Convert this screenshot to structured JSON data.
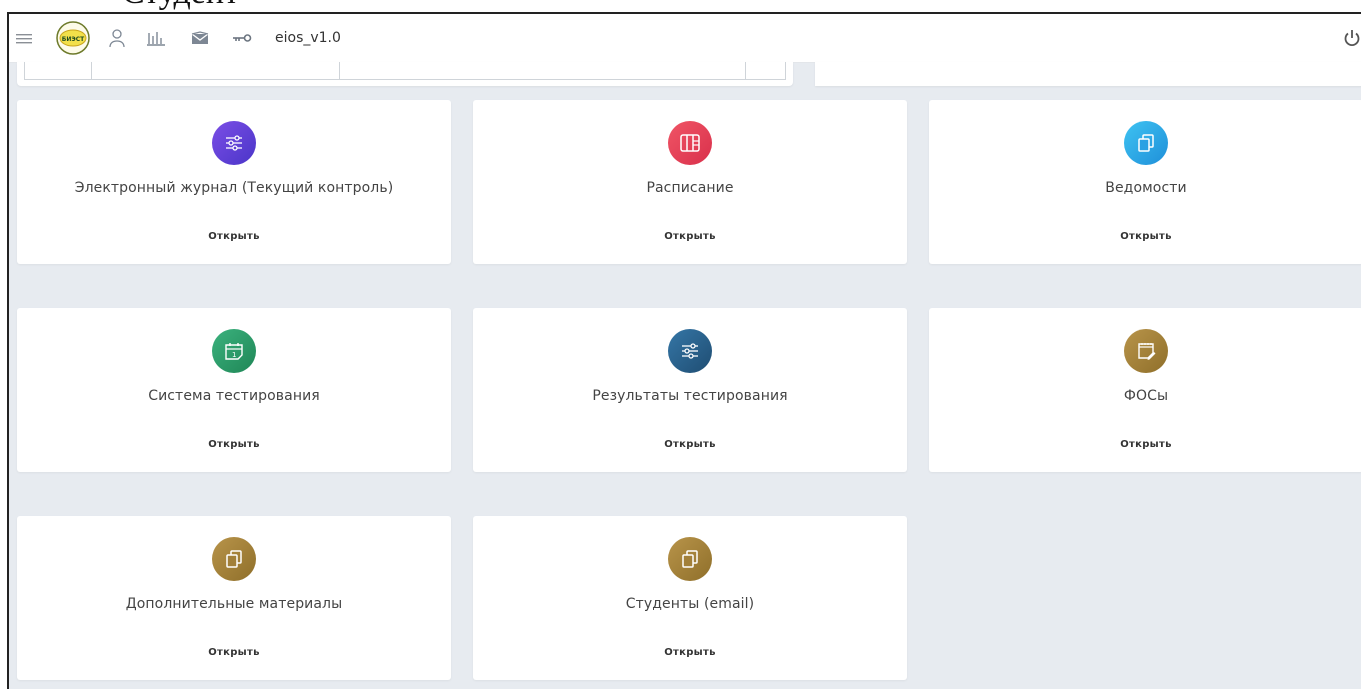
{
  "doc_heading": "Студент",
  "topbar": {
    "app_title": "eios_v1.0",
    "logo_text": "БИЭСТ"
  },
  "cards": [
    {
      "title": "Электронный журнал (Текущий контроль)",
      "open_label": "Открыть",
      "icon": "sliders-icon",
      "color": "#6a3fd6"
    },
    {
      "title": "Расписание",
      "open_label": "Открыть",
      "icon": "schedule-columns-icon",
      "color": "#e73f57"
    },
    {
      "title": "Ведомости",
      "open_label": "Открыть",
      "icon": "copy-icon",
      "color": "#2ea7e6"
    },
    {
      "title": "Система тестирования",
      "open_label": "Открыть",
      "icon": "calendar-icon",
      "color": "#2f9a6a"
    },
    {
      "title": "Результаты тестирования",
      "open_label": "Открыть",
      "icon": "sliders-icon",
      "color": "#2b5f89"
    },
    {
      "title": "ФОСы",
      "open_label": "Открыть",
      "icon": "notepad-edit-icon",
      "color": "#a88434"
    },
    {
      "title": "Дополнительные материалы",
      "open_label": "Открыть",
      "icon": "copy-icon",
      "color": "#a88434"
    },
    {
      "title": "Студенты (email)",
      "open_label": "Открыть",
      "icon": "copy-icon",
      "color": "#a88434"
    }
  ]
}
